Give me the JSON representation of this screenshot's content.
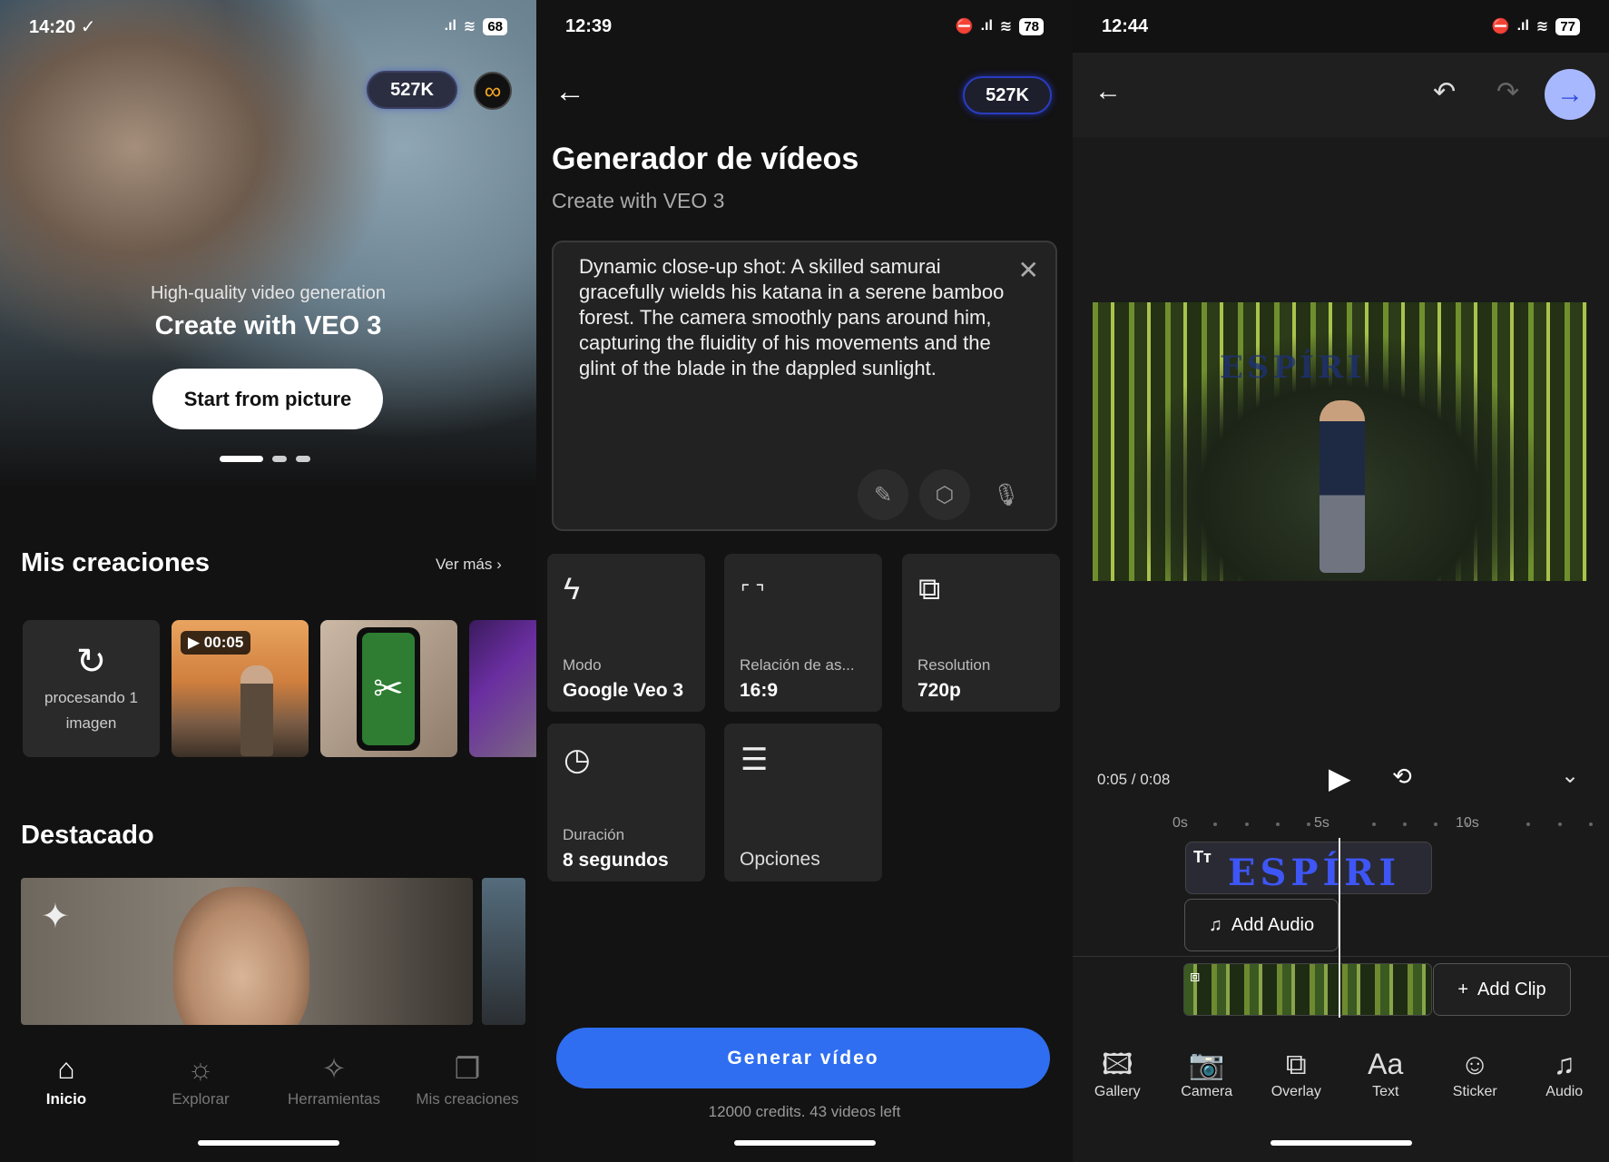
{
  "screen1": {
    "status": {
      "time": "14:20",
      "check": "✓",
      "signal": ".ıl",
      "wifi": "≋",
      "battery": "68"
    },
    "credits": "527K",
    "logo": "∞",
    "hero": {
      "subtitle": "High-quality video generation",
      "title": "Create with VEO 3",
      "button": "Start from picture"
    },
    "creations": {
      "title": "Mis creaciones",
      "more": "Ver más",
      "processing": "procesando 1 imagen",
      "video_badge": "▶ 00:05"
    },
    "featured": {
      "title": "Destacado"
    },
    "nav": [
      {
        "label": "Inicio",
        "icon": "home-icon"
      },
      {
        "label": "Explorar",
        "icon": "bulb-icon"
      },
      {
        "label": "Herramientas",
        "icon": "sparkles-icon"
      },
      {
        "label": "Mis creaciones",
        "icon": "folder-icon"
      }
    ]
  },
  "screen2": {
    "status": {
      "time": "12:39",
      "battery": "78"
    },
    "credits": "527K",
    "title": "Generador de vídeos",
    "subtitle": "Create with VEO 3",
    "prompt": "Dynamic close-up shot: A skilled samurai gracefully wields his katana in a serene bamboo forest. The camera smoothly pans around him, capturing the fluidity of his movements and the glint of the blade in the dappled sunlight.",
    "cards": [
      {
        "label": "Modo",
        "value": "Google Veo 3",
        "icon": "bolt-icon"
      },
      {
        "label": "Relación de as...",
        "value": "16:9",
        "icon": "aspect-icon"
      },
      {
        "label": "Resolution",
        "value": "720p",
        "icon": "layers-icon"
      },
      {
        "label": "Duración",
        "value": "8 segundos",
        "icon": "clock-icon"
      },
      {
        "label": "",
        "value": "Opciones",
        "icon": "sliders-icon"
      }
    ],
    "generate": "Generar vídeo",
    "credits_line": "12000 credits. 43 videos left"
  },
  "screen3": {
    "status": {
      "time": "12:44",
      "battery": "77"
    },
    "time_display": "0:05 / 0:08",
    "watermark": "ESPÍRI",
    "ruler": [
      "0s",
      "5s",
      "10s"
    ],
    "text_track_icon": "Tт",
    "text_track": "ESPÍRI",
    "add_audio": "Add Audio",
    "add_clip": "Add Clip",
    "tools": [
      {
        "label": "Gallery",
        "icon": "gallery-icon"
      },
      {
        "label": "Camera",
        "icon": "camera-icon"
      },
      {
        "label": "Overlay",
        "icon": "overlay-icon"
      },
      {
        "label": "Text",
        "icon": "text-icon"
      },
      {
        "label": "Sticker",
        "icon": "sticker-icon"
      },
      {
        "label": "Audio",
        "icon": "audio-icon"
      }
    ]
  }
}
